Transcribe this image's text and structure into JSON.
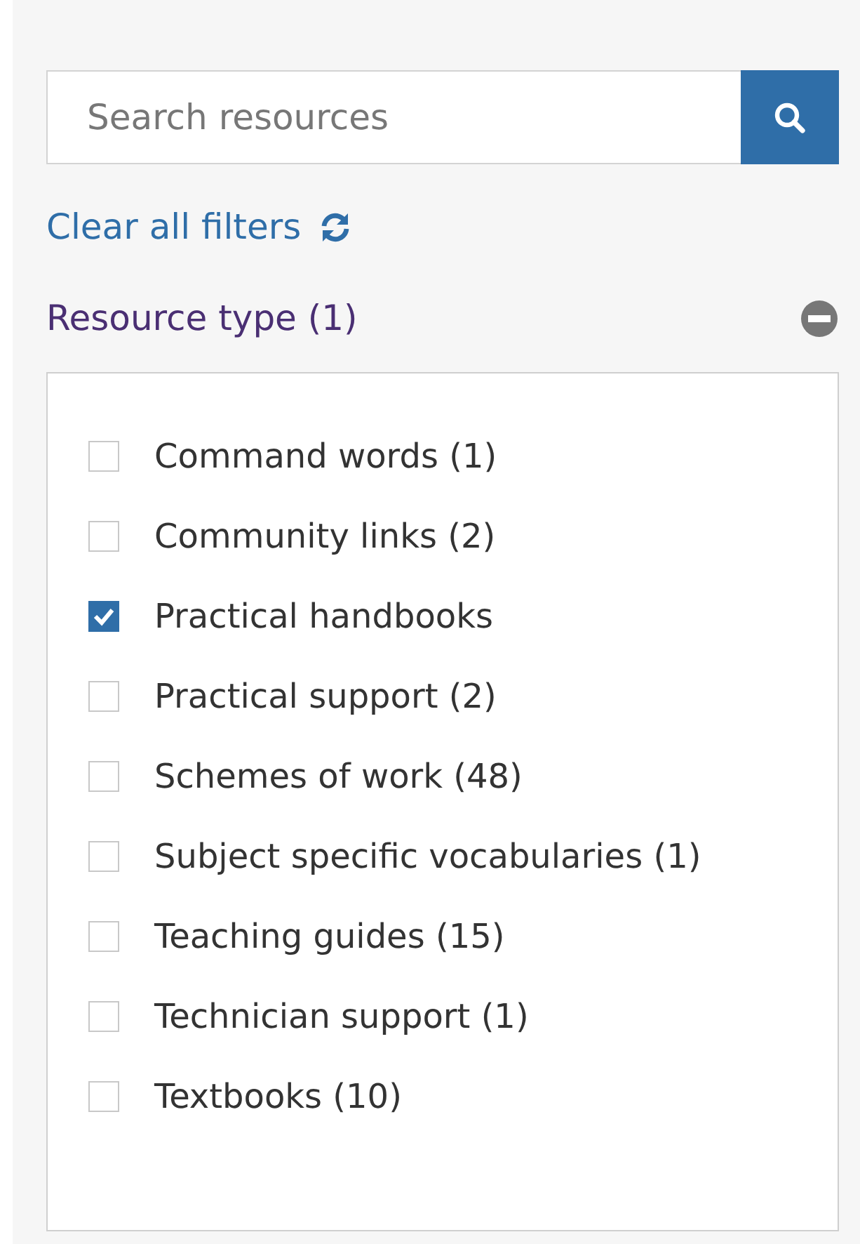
{
  "search": {
    "placeholder": "Search resources"
  },
  "clear_filters": {
    "label": "Clear all filters"
  },
  "filter_group": {
    "title": "Resource type (1)",
    "expanded": true,
    "options": [
      {
        "label": "Command words (1)",
        "checked": false
      },
      {
        "label": "Community links (2)",
        "checked": false
      },
      {
        "label": "Practical handbooks",
        "checked": true
      },
      {
        "label": "Practical support (2)",
        "checked": false
      },
      {
        "label": "Schemes of work (48)",
        "checked": false
      },
      {
        "label": "Subject specific vocabularies (1)",
        "checked": false
      },
      {
        "label": "Teaching guides (15)",
        "checked": false
      },
      {
        "label": "Technician support (1)",
        "checked": false
      },
      {
        "label": "Textbooks (10)",
        "checked": false
      }
    ]
  }
}
